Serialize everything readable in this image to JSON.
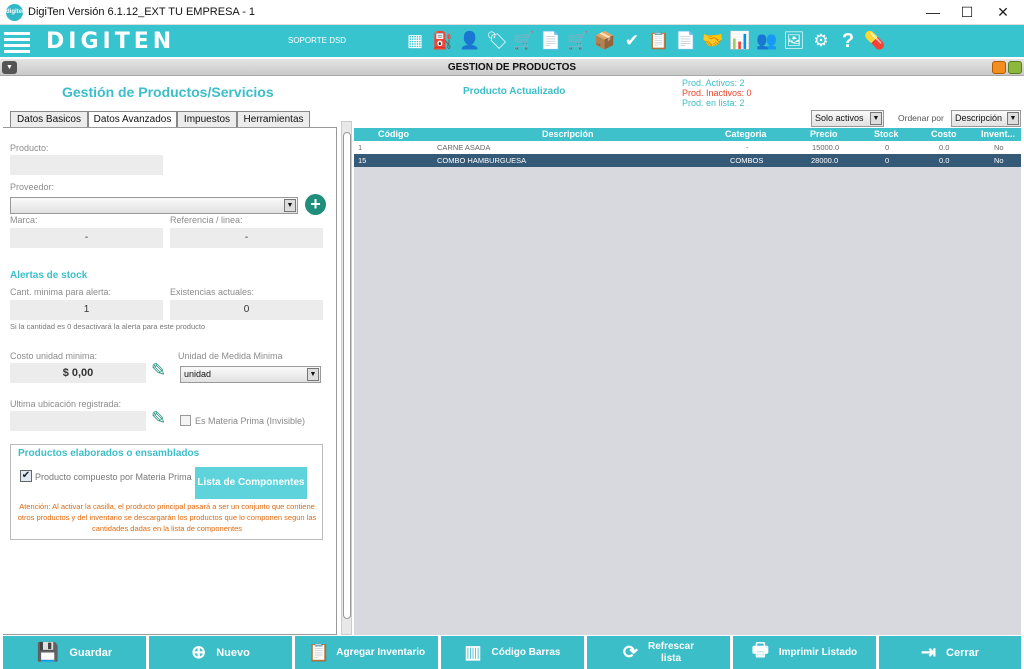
{
  "window": {
    "title": "DigiTen Versión 6.1.12_EXT TU EMPRESA - 1",
    "logo_text": "digiten",
    "min": "—",
    "max": "☐",
    "close": "✕"
  },
  "toolbar": {
    "brand": "DIGITEN",
    "support": "SOPORTE DSD",
    "icons": [
      "▦",
      "⛽",
      "👤",
      "🏷",
      "🛒",
      "📄",
      "🛒",
      "📦",
      "✔",
      "📋",
      "📄",
      "🤝",
      "📊",
      "👥",
      "🖼",
      "⚙",
      "?",
      "💊"
    ]
  },
  "module": {
    "title": "GESTION DE PRODUCTOS",
    "collapse": "▼"
  },
  "header": {
    "title": "Gestión de Productos/Servicios",
    "status": "Producto Actualizado",
    "active": "Prod. Activos: 2",
    "inactive": "Prod. Inactivos: 0",
    "listed": "Prod. en lista: 2"
  },
  "tabs": [
    "Datos Basicos",
    "Datos Avanzados",
    "Impuestos",
    "Herramientas"
  ],
  "form": {
    "producto_label": "Producto:",
    "producto_value": "",
    "proveedor_label": "Proveedor:",
    "proveedor_value": "",
    "marca_label": "Marca:",
    "marca_value": "-",
    "referencia_label": "Referencia / linea:",
    "referencia_value": "-",
    "alertas_title": "Alertas de stock",
    "cant_min_label": "Cant. minima para alerta:",
    "cant_min_value": "1",
    "exist_label": "Existencias actuales:",
    "exist_value": "0",
    "alert_note": "Si la cantidad es 0 desactivará la alerta para este producto",
    "costo_label": "Costo unidad minima:",
    "costo_value": "$ 0,00",
    "unidad_label": "Unidad de Medida Minima",
    "unidad_value": "unidad",
    "ubicacion_label": "Ultima ubicación registrada:",
    "ubicacion_value": "",
    "materia_prima_label": "Es Materia Prima (Invisible)",
    "elaborados_title": "Productos elaborados o ensamblados",
    "compuesto_label": "Producto compuesto por Materia Prima",
    "componentes_button": "Lista de Componentes",
    "warning": "Atención: Al activar la casilla, el producto principal pasará a ser un conjunto que contiene otros productos y del inventario se descargarán los productos que lo componen segun las cantidades dadas en la lista de componentes"
  },
  "filters": {
    "active_filter": "Solo activos",
    "order_label": "Ordenar por",
    "order_value": "Descripción"
  },
  "grid": {
    "columns": [
      "Código",
      "Descripción",
      "Categoria",
      "Precio",
      "Stock",
      "Costo",
      "Invent..."
    ],
    "rows": [
      {
        "codigo": "1",
        "descripcion": "CARNE ASADA",
        "categoria": "-",
        "precio": "15000.0",
        "stock": "0",
        "costo": "0.0",
        "inventario": "No"
      },
      {
        "codigo": "15",
        "descripcion": "COMBO HAMBURGUESA",
        "categoria": "COMBOS",
        "precio": "28000.0",
        "stock": "0",
        "costo": "0.0",
        "inventario": "No"
      }
    ]
  },
  "buttons": {
    "guardar": "Guardar",
    "nuevo": "Nuevo",
    "agregar": "Agregar Inventario",
    "codigo": "Código Barras",
    "refrescar1": "Refrescar",
    "refrescar2": "lista",
    "imprimir": "Imprimir Listado",
    "cerrar": "Cerrar"
  },
  "colors": {
    "accent": "#3cbec9",
    "selected_row": "#355a78",
    "warning": "#e06a10",
    "inactive": "#e8442c"
  }
}
